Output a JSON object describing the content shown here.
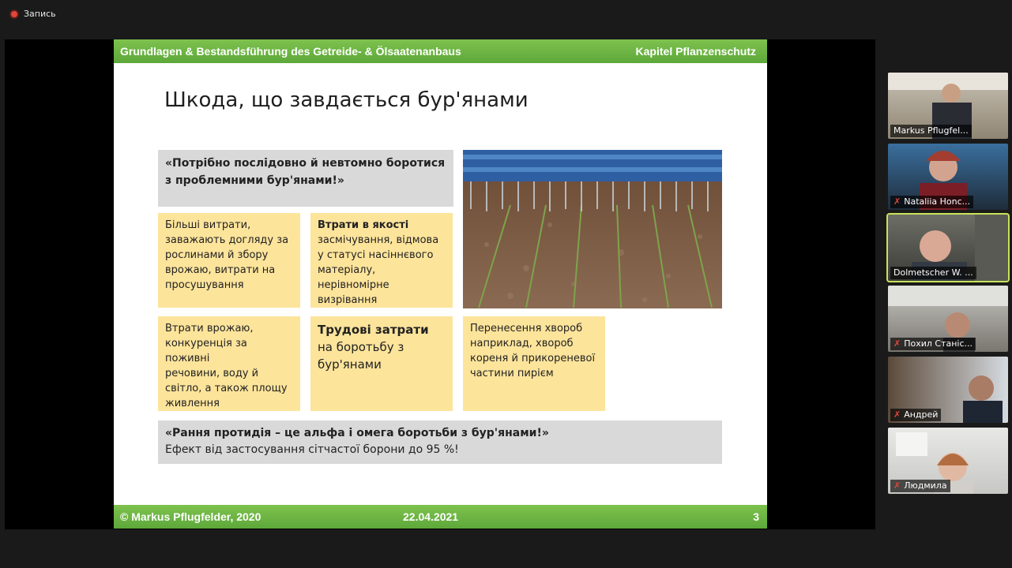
{
  "recording": {
    "label": "Запись"
  },
  "slide": {
    "header_left": "Grundlagen & Bestandsführung des Getreide- & Ölsaatenanbaus",
    "header_right": "Kapitel Pflanzenschutz",
    "title": "Шкода, що завдається бур'янами",
    "quote_top_line1": "«Потрібно послідовно й невтомно боротися",
    "quote_top_line2": "з проблемними бур'янами!»",
    "box1": [
      "Більші витрати,",
      "заважають догляду за",
      "рослинами й збору",
      "врожаю, витрати на",
      "просушування"
    ],
    "box2_title": "Втрати в якості",
    "box2": [
      "засмічування, відмова",
      "у статусі насіннєвого",
      "матеріалу,",
      "нерівномірне",
      "визрівання"
    ],
    "box3": [
      "Втрати врожаю,",
      "конкуренція за поживні",
      "речовини, воду й",
      "світло, а також площу",
      "живлення"
    ],
    "box4_title": "Трудові затрати",
    "box4": [
      "на боротьбу з",
      "бур'янами"
    ],
    "box5": [
      "Перенесення хвороб",
      "наприклад, хвороб",
      "кореня й прикореневої",
      "частини пирієм"
    ],
    "quote_bottom": "«Рання протидія – це альфа і омега боротьби з бур'янами!»",
    "quote_bottom_sub": "Ефект від застосування сітчастої борони до 95 %!",
    "footer_left": "© Markus Pflugfelder, 2020",
    "footer_center": "22.04.2021",
    "footer_right": "3"
  },
  "participants": [
    {
      "name": "Markus Pflugfel...",
      "muted": false
    },
    {
      "name": "Nataliia Honc...",
      "muted": true
    },
    {
      "name": "Dolmetscher W. ...",
      "muted": false,
      "active": true
    },
    {
      "name": "Похил Станіс...",
      "muted": true
    },
    {
      "name": "Андрей",
      "muted": true
    },
    {
      "name": "Людмила",
      "muted": true
    }
  ],
  "colors": {
    "slide_green": "#6cb544",
    "box_yellow": "#fde49b",
    "box_gray": "#d9d9d9",
    "active_speaker": "#c8e25a"
  }
}
